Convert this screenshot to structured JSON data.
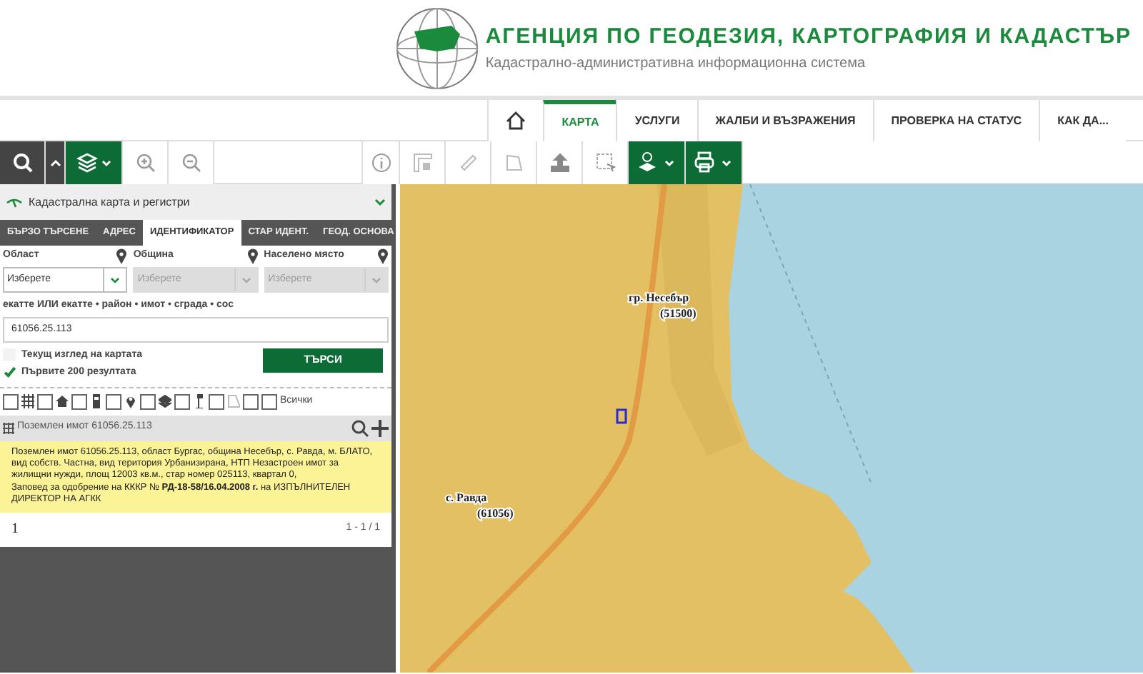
{
  "header": {
    "title": "АГЕНЦИЯ ПО ГЕОДЕЗИЯ, КАРТОГРАФИЯ И КАДАСТЪР",
    "subtitle": "Кадастрално-административна информационна система"
  },
  "nav": [
    {
      "label": "КАРТА",
      "selected": true
    },
    {
      "label": "УСЛУГИ",
      "selected": false
    },
    {
      "label": "ЖАЛБИ И ВЪЗРАЖЕНИЯ",
      "selected": false
    },
    {
      "label": "ПРОВЕРКА НА СТАТУС",
      "selected": false
    },
    {
      "label": "КАК ДА...",
      "selected": false
    }
  ],
  "panel": {
    "title": "Кадастрална карта и регистри",
    "tabs": [
      {
        "label": "БЪРЗО ТЪРСЕНЕ",
        "selected": false
      },
      {
        "label": "АДРЕС",
        "selected": false
      },
      {
        "label": "ИДЕНТИФИКАТОР",
        "selected": true
      },
      {
        "label": "СТАР ИДЕНТ.",
        "selected": false
      },
      {
        "label": "ГЕОД. ОСНОВА",
        "selected": false
      }
    ],
    "selects": [
      {
        "label": "Област",
        "placeholder": "Изберете",
        "disabled": false
      },
      {
        "label": "Община",
        "placeholder": "Изберете",
        "disabled": true
      },
      {
        "label": "Населено място",
        "placeholder": "Изберете",
        "disabled": true
      }
    ],
    "id_label": "екатте ИЛИ екатте • район • имот • сграда • сос",
    "id_value": "61056.25.113",
    "options": [
      {
        "label": "Текущ изглед на картата",
        "checked": false
      },
      {
        "label": "Първите 200 резултата",
        "checked": true
      }
    ],
    "search_button": "ТЪРСИ",
    "filters": [
      {
        "checked": false
      },
      {
        "checked": false
      },
      {
        "checked": false
      },
      {
        "checked": false
      },
      {
        "checked": false
      },
      {
        "checked": false
      },
      {
        "checked": false
      },
      {
        "checked": false
      },
      {
        "checked": false,
        "label": "Всички"
      }
    ],
    "result": {
      "title": "Поземлен имот 61056.25.113",
      "lines": [
        "Поземлен имот 61056.25.113, област Бургас, община Несебър, с. Равда, м. БЛАТО, вид собств. Частна, вид територия Урбанизирана, НТП Незастроен имот за жилищни нужди, площ 12003 кв.м., стар номер 025113, квартал 0,",
        "Заповед за одобрение на КККР № **РД-18-58/16.04.2008 г.** на ИЗПЪЛНИТЕЛЕН ДИРЕКТОР НА АГКК"
      ]
    },
    "pagination": {
      "page": "1",
      "range": "1 - 1 / 1"
    }
  },
  "map": {
    "labels": [
      {
        "name": "гр. Несебър",
        "code": "(51500)"
      },
      {
        "name": "с. Равда",
        "code": "(61056)"
      }
    ]
  }
}
